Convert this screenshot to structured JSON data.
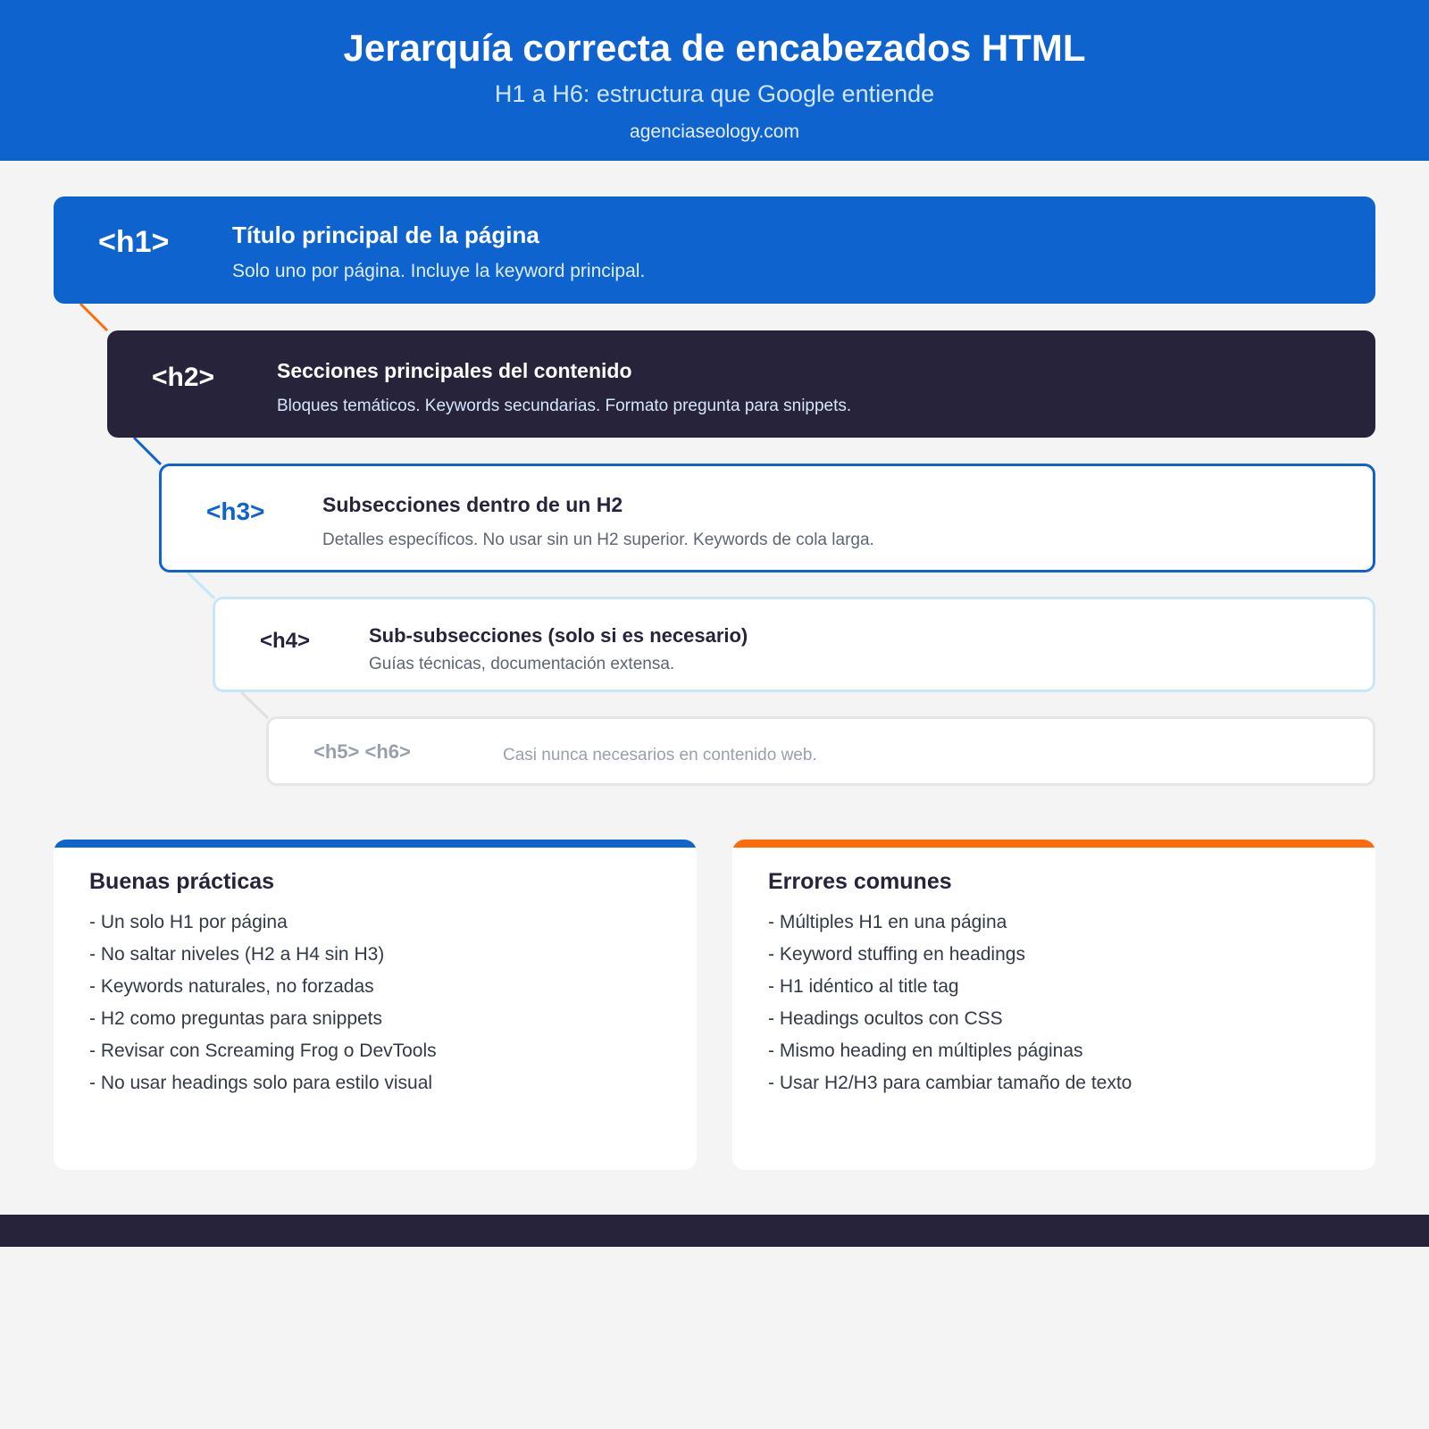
{
  "header": {
    "title": "Jerarquía correcta de encabezados HTML",
    "subtitle": "H1 a H6: estructura que Google entiende",
    "site": "agenciaseology.com"
  },
  "levels": [
    {
      "tag": "<h1>",
      "title": "Título principal de la página",
      "desc": "Solo uno por página. Incluye la keyword principal."
    },
    {
      "tag": "<h2>",
      "title": "Secciones principales del contenido",
      "desc": "Bloques temáticos. Keywords secundarias. Formato pregunta para snippets."
    },
    {
      "tag": "<h3>",
      "title": "Subsecciones dentro de un H2",
      "desc": "Detalles específicos. No usar sin un H2 superior. Keywords de cola larga."
    },
    {
      "tag": "<h4>",
      "title": "Sub-subsecciones (solo si es necesario)",
      "desc": "Guías técnicas, documentación extensa."
    },
    {
      "tag": "<h5> <h6>",
      "desc": "Casi nunca necesarios en contenido web."
    }
  ],
  "good_practices": {
    "title": "Buenas prácticas",
    "items": [
      "- Un solo H1 por página",
      "- No saltar niveles (H2 a H4 sin H3)",
      "- Keywords naturales, no forzadas",
      "- H2 como preguntas para snippets",
      "- Revisar con Screaming Frog o DevTools",
      "- No usar headings solo para estilo visual"
    ]
  },
  "common_errors": {
    "title": "Errores comunes",
    "items": [
      "- Múltiples H1 en una página",
      "- Keyword stuffing en headings",
      "- H1 idéntico al title tag",
      "- Headings ocultos con CSS",
      "- Mismo heading en múltiples páginas",
      "- Usar H2/H3 para cambiar tamaño de texto"
    ]
  },
  "colors": {
    "primary_blue": "#0f63cf",
    "dark_navy": "#26233a",
    "accent_orange": "#ff6b0a",
    "light_blue_border": "#c6e6fb",
    "background": "#f4f4f4"
  }
}
